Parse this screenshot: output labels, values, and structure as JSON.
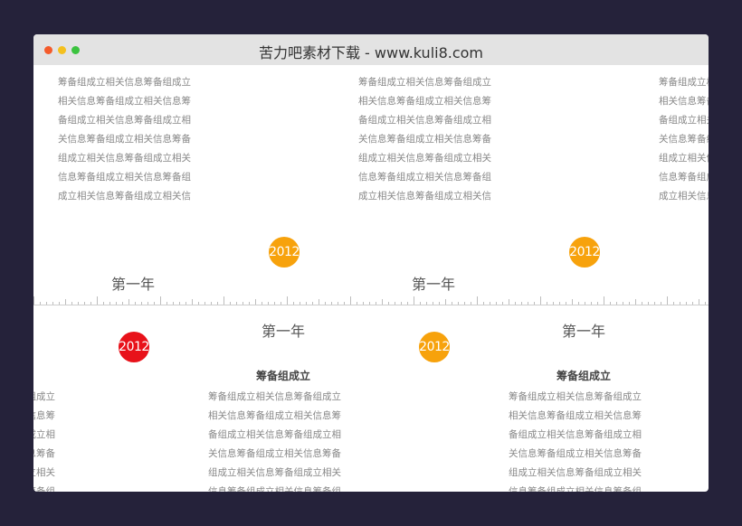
{
  "window": {
    "title": "苦力吧素材下载 - www.kuli8.com",
    "colors": {
      "close": "#f45b2b",
      "minimize": "#f4c01e",
      "maximize": "#3bc33f"
    }
  },
  "timeline": {
    "top_items": [
      {
        "text": "筹备组成立相关信息筹备组成立\n相关信息筹备组成立相关信息筹\n备组成立相关信息筹备组成立相\n关信息筹备组成立相关信息筹备\n组成立相关信息筹备组成立相关\n信息筹备组成立相关信息筹备组\n成立相关信息筹备组成立相关信",
        "year_label": "第一年",
        "badge": "2012",
        "badge_color": "#f7a20c"
      },
      {
        "text": "筹备组成立相关信息筹备组成立\n相关信息筹备组成立相关信息筹\n备组成立相关信息筹备组成立相\n关信息筹备组成立相关信息筹备\n组成立相关信息筹备组成立相关\n信息筹备组成立相关信息筹备组\n成立相关信息筹备组成立相关信",
        "year_label": "第一年",
        "badge": "2012",
        "badge_color": "#f7a20c"
      },
      {
        "text": "筹备组成立相关信息筹备组成立\n相关信息筹备组成立相关信息筹\n备组成立相关信息筹备组成立相\n关信息筹备组成立相关信息筹备\n组成立相关信息筹备组成立相关\n信息筹备组成立相关信息筹备组\n成立相关信息筹备组成立相关信"
      }
    ],
    "bottom_items": [
      {
        "text": "筹备组成立相关信息筹备组成立\n相关信息筹备组成立相关信息筹\n备组成立相关信息筹备组成立相\n关信息筹备组成立相关信息筹备\n组成立相关信息筹备组成立相关\n信息筹备组成立相关信息筹备组\n成立相关信息筹备组成立相关信",
        "badge": "2012",
        "badge_color": "#e8121a"
      },
      {
        "year_label": "第一年",
        "heading": "筹备组成立",
        "text": "筹备组成立相关信息筹备组成立\n相关信息筹备组成立相关信息筹\n备组成立相关信息筹备组成立相\n关信息筹备组成立相关信息筹备\n组成立相关信息筹备组成立相关\n信息筹备组成立相关信息筹备组\n成立相关信息筹备组成立相关信",
        "badge": "2012",
        "badge_color": "#f7a20c"
      },
      {
        "year_label": "第一年",
        "heading": "筹备组成立",
        "text": "筹备组成立相关信息筹备组成立\n相关信息筹备组成立相关信息筹\n备组成立相关信息筹备组成立相\n关信息筹备组成立相关信息筹备\n组成立相关信息筹备组成立相关\n信息筹备组成立相关信息筹备组\n成立相关信息筹备组成立相关信"
      }
    ]
  }
}
